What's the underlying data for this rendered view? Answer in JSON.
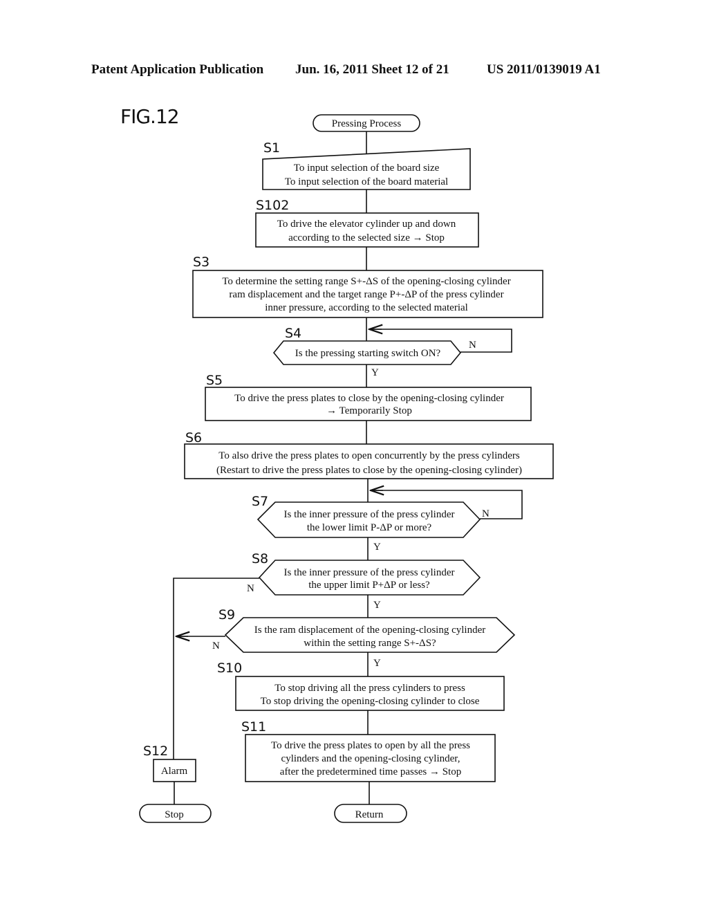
{
  "header": {
    "publication": "Patent Application Publication",
    "date_sheet": "Jun. 16, 2011  Sheet 12 of 21",
    "number": "US 2011/0139019 A1"
  },
  "figure_label": "FIG.12",
  "flowchart": {
    "start": "Pressing Process",
    "steps": {
      "S1": {
        "label": "S1",
        "lines": [
          "To input selection of the board size",
          "To input selection of the board material"
        ]
      },
      "S102": {
        "label": "S102",
        "lines": [
          "To drive the elevator cylinder up and down",
          "according to the selected size → Stop"
        ]
      },
      "S3": {
        "label": "S3",
        "lines": [
          "To determine the setting range S+-ΔS of the opening-closing cylinder",
          "ram displacement and the target range P+-ΔP of the press cylinder",
          "inner pressure, according to the selected material"
        ]
      },
      "S4": {
        "label": "S4",
        "lines": [
          "Is the pressing starting switch ON?"
        ]
      },
      "S5": {
        "label": "S5",
        "lines": [
          "To drive the press plates to close by the opening-closing cylinder",
          "→ Temporarily Stop"
        ]
      },
      "S6": {
        "label": "S6",
        "lines": [
          "To also drive the press plates to open concurrently by the press cylinders",
          "(Restart to drive the press plates to close by the opening-closing cylinder)"
        ]
      },
      "S7": {
        "label": "S7",
        "lines": [
          "Is the inner pressure of the press cylinder",
          "the lower limit P-ΔP or more?"
        ]
      },
      "S8": {
        "label": "S8",
        "lines": [
          "Is the inner pressure of the press cylinder",
          "the upper limit P+ΔP or less?"
        ]
      },
      "S9": {
        "label": "S9",
        "lines": [
          "Is the ram displacement of the opening-closing cylinder",
          "within the setting range S+-ΔS?"
        ]
      },
      "S10": {
        "label": "S10",
        "lines": [
          "To stop driving all the press cylinders to press",
          "To stop driving the opening-closing cylinder to close"
        ]
      },
      "S11": {
        "label": "S11",
        "lines": [
          "To drive the press plates to open by all the press",
          "cylinders and the opening-closing cylinder,",
          "after the predetermined time passes → Stop"
        ]
      },
      "S12": {
        "label": "S12",
        "lines": [
          "Alarm"
        ]
      }
    },
    "branch_yes": "Y",
    "branch_no": "N",
    "end_stop": "Stop",
    "end_return": "Return"
  }
}
